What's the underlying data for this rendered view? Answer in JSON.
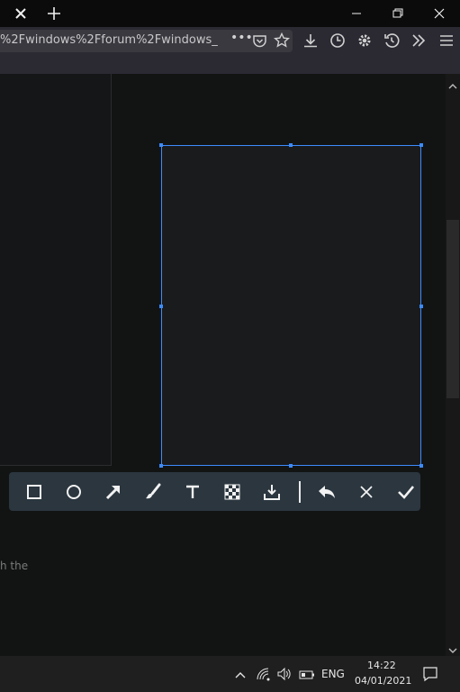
{
  "browser": {
    "url_text": "%2Fwindows%2Fforum%2Fwindows_",
    "more_actions_glyph": "•••"
  },
  "page": {
    "snippet": "h the"
  },
  "taskbar": {
    "language": "ENG",
    "time": "14:22",
    "date": "04/01/2021"
  },
  "annotation_toolbar": {
    "tools": [
      "rectangle-icon",
      "circle-icon",
      "arrow-icon",
      "brush-icon",
      "text-icon",
      "mosaic-icon",
      "download-icon",
      "undo-icon",
      "cancel-icon",
      "confirm-icon"
    ]
  },
  "colors": {
    "selection": "#3d8bfd",
    "toolbar": "#2b363f",
    "background": "#121414"
  }
}
